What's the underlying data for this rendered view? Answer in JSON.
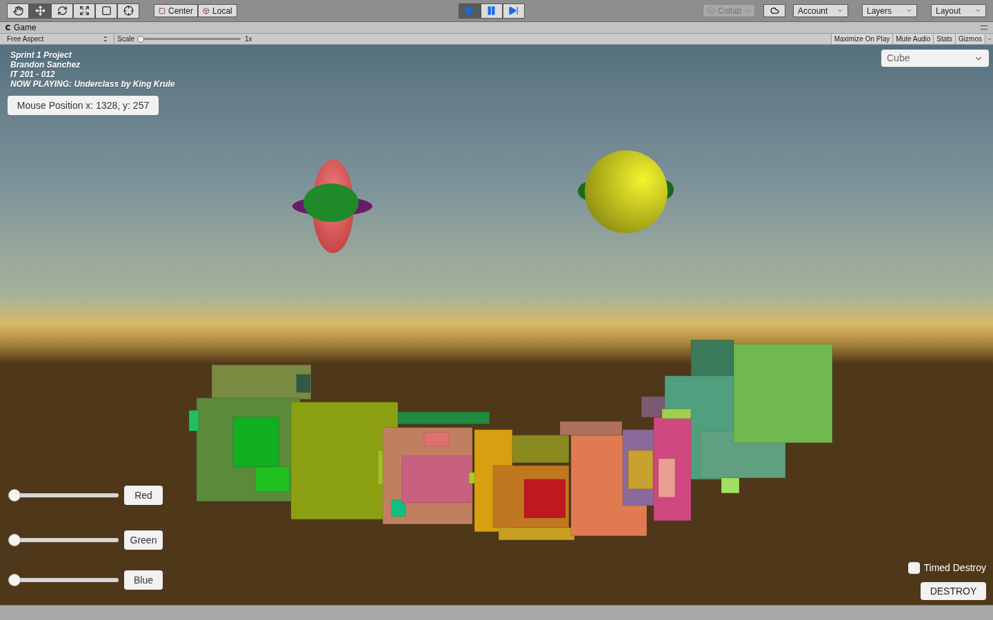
{
  "toolbar": {
    "tools": [
      {
        "kind": "hand",
        "selected": false
      },
      {
        "kind": "move",
        "selected": true
      },
      {
        "kind": "rotate",
        "selected": false
      },
      {
        "kind": "scale",
        "selected": false
      },
      {
        "kind": "rect",
        "selected": false
      },
      {
        "kind": "transform",
        "selected": false
      }
    ],
    "pivot": [
      {
        "kind": "pivot",
        "label": "Center"
      },
      {
        "kind": "space",
        "label": "Local"
      }
    ],
    "playback": [
      {
        "kind": "play",
        "on": true
      },
      {
        "kind": "pause",
        "on": false
      },
      {
        "kind": "step",
        "on": false
      }
    ],
    "collab": {
      "label": "Collab",
      "disabled": true
    },
    "menus": [
      {
        "label": "Account"
      },
      {
        "label": "Layers"
      },
      {
        "label": "Layout"
      }
    ]
  },
  "tab": {
    "title": "Game"
  },
  "game_toolbar": {
    "aspect": "Free Aspect",
    "scale_label": "Scale",
    "scale": {
      "level": 0
    },
    "scale_value": "1x",
    "buttons": [
      {
        "label": "Maximize On Play",
        "on": false
      },
      {
        "label": "Mute Audio",
        "on": false
      },
      {
        "label": "Stats",
        "on": false
      },
      {
        "label": "Gizmos",
        "on": false
      }
    ]
  },
  "game": {
    "info_lines": [
      "Sprint 1 Project",
      "Brandon Sanchez",
      "IT 201 - 012",
      "NOW PLAYING: Underclass by King Krule"
    ],
    "mouse_position": "Mouse Position x: 1328, y: 257",
    "shape_select": {
      "value": "Cube"
    },
    "sliders": [
      {
        "level": 0,
        "button": "Red"
      },
      {
        "level": 0,
        "button": "Green"
      },
      {
        "level": 0,
        "button": "Blue"
      }
    ],
    "timed_destroy": {
      "label": "Timed Destroy",
      "checked": false
    },
    "destroy_button": "DESTROY"
  }
}
